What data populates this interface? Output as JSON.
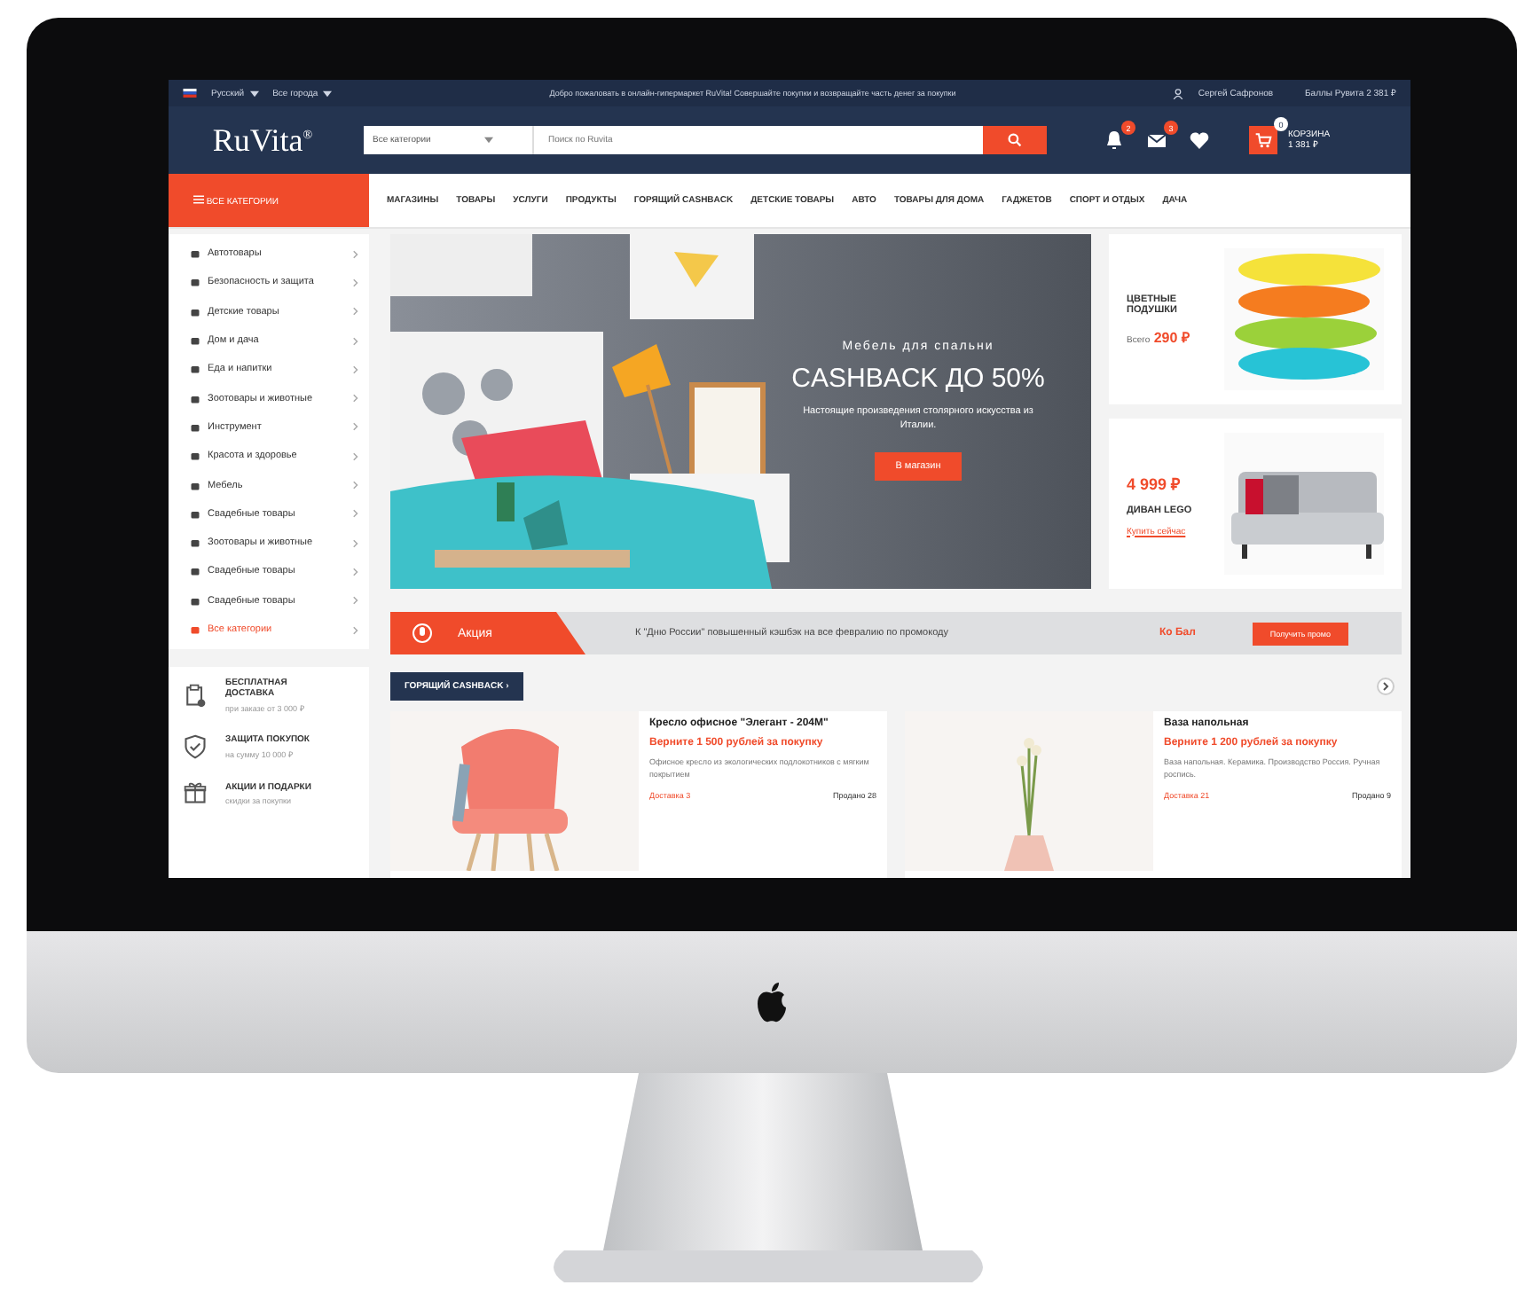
{
  "top_bar": {
    "language": "Русский",
    "city": "Все города",
    "announcement": "Добро пожаловать в онлайн-гипермаркет RuVita! Совершайте покупки и возвращайте часть денег за покупки",
    "user": "Сергей Сафронов",
    "balance": "Баллы Рувита 2 381 ₽"
  },
  "header": {
    "logo": "RuVita",
    "logo_mark": "®",
    "search_category": "Все категории",
    "search_placeholder": "Поиск по Ruvita",
    "badges": [
      "2",
      "3"
    ],
    "cart_badge": "0",
    "cart_label": "КОРЗИНА",
    "cart_total": "1 381 ₽"
  },
  "nav": {
    "all_categories": "ВСЕ КАТЕГОРИИ",
    "items": [
      "МАГАЗИНЫ",
      "ТОВАРЫ",
      "УСЛУГИ",
      "ПРОДУКТЫ",
      "ГОРЯЩИЙ CASHBACK",
      "ДЕТСКИЕ ТОВАРЫ",
      "АВТО",
      "ТОВАРЫ ДЛЯ ДОМА",
      "ГАДЖЕТОВ",
      "СПОРТ И ОТДЫХ",
      "ДАЧА"
    ]
  },
  "categories": [
    {
      "label": "Автотовары",
      "kind": "item"
    },
    {
      "label": "Безопасность и защита",
      "kind": "item"
    },
    {
      "label": "Детские товары",
      "kind": "item"
    },
    {
      "label": "Дом и дача",
      "kind": "item"
    },
    {
      "label": "Еда и напитки",
      "kind": "item"
    },
    {
      "label": "Зоотовары и животные",
      "kind": "item"
    },
    {
      "label": "Инструмент",
      "kind": "item"
    },
    {
      "label": "Красота и здоровье",
      "kind": "item"
    },
    {
      "label": "Мебель",
      "kind": "item"
    },
    {
      "label": "Свадебные товары",
      "kind": "item"
    },
    {
      "label": "Зоотовары и животные",
      "kind": "item"
    },
    {
      "label": "Свадебные товары",
      "kind": "item"
    },
    {
      "label": "Свадебные товары",
      "kind": "item"
    },
    {
      "label": "Все категории",
      "kind": "all"
    }
  ],
  "features": [
    {
      "title": "БЕСПЛАТНАЯ ДОСТАВКА",
      "note": "при заказе от 3 000 ₽"
    },
    {
      "title": "ЗАЩИТА ПОКУПОК",
      "note": "на сумму 10 000 ₽"
    },
    {
      "title": "АКЦИИ И ПОДАРКИ",
      "note": "скидки за покупки"
    }
  ],
  "hero": {
    "subtitle": "Мебель для спальни",
    "title": "CASHBACK ДО 50%",
    "text": "Настоящие произведения столярного искусства из Италии.",
    "button": "В магазин"
  },
  "side_cards": [
    {
      "title": "ЦВЕТНЫЕ ПОДУШКИ",
      "prefix": "Всего",
      "price": "290 ₽",
      "kind": "pillows"
    },
    {
      "price": "4 999 ₽",
      "title": "ДИВАН LEGO",
      "link": "Купить сейчас",
      "kind": "sofa"
    }
  ],
  "promo": {
    "label": "Акция",
    "text": "К \"Дню России\" повышенный кэшбэк на все февралию по промокоду",
    "code": "Ко Бал",
    "button": "Получить промо"
  },
  "hot_cashback": {
    "tag": "ГОРЯЩИЙ CASHBACK ›"
  },
  "products": [
    {
      "name": "Кресло офисное \"Элегант - 204М\"",
      "cashback": "Верните 1 500 рублей за покупку",
      "description": "Офисное кресло из экологических подлокотников с мягким покрытием",
      "delivery": "Доставка 3",
      "sold": "Продано 28",
      "kind": "chair"
    },
    {
      "name": "Ваза напольная",
      "cashback": "Верните 1 200 рублей за покупку",
      "description": "Ваза напольная. Керамика. Производство Россия. Ручная роспись.",
      "delivery": "Доставка 21",
      "sold": "Продано 9",
      "kind": "vase"
    }
  ]
}
